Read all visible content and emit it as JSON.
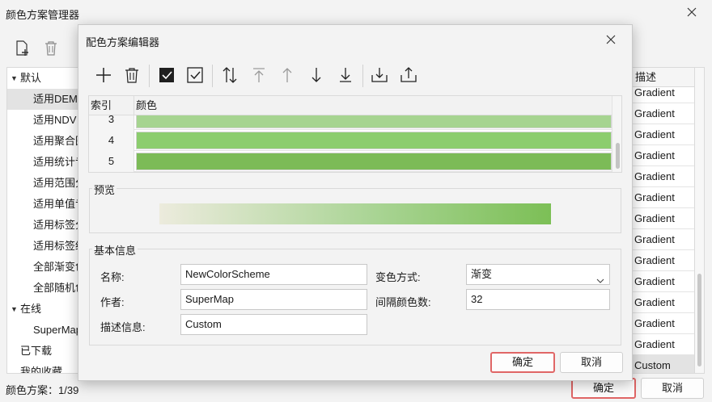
{
  "manager": {
    "title": "颜色方案管理器",
    "tree": {
      "groups": [
        {
          "label": "默认",
          "expanded": true,
          "items": [
            "适用DEM",
            "适用NDV",
            "适用聚合图",
            "适用统计专",
            "适用范围分",
            "适用单值专",
            "适用标签分",
            "适用标签统",
            "全部渐变色",
            "全部随机色"
          ]
        },
        {
          "label": "在线",
          "expanded": true,
          "items": [
            "SuperMap"
          ]
        }
      ],
      "extra": [
        "已下载",
        "我的收藏"
      ]
    },
    "table": {
      "header": "描述",
      "rows": [
        "Gradient",
        "Gradient",
        "Gradient",
        "Gradient",
        "Gradient",
        "Gradient",
        "Gradient",
        "Gradient",
        "Gradient",
        "Gradient",
        "Gradient",
        "Gradient",
        "Gradient",
        "Custom"
      ]
    },
    "status": "颜色方案：1/39",
    "ok_label": "确定",
    "cancel_label": "取消"
  },
  "editor": {
    "title": "配色方案编辑器",
    "grid": {
      "col_index": "索引",
      "col_color": "颜色",
      "rows": [
        {
          "index": "3",
          "color": "#a6d490"
        },
        {
          "index": "4",
          "color": "#8ccd6e"
        },
        {
          "index": "5",
          "color": "#7cbb57"
        }
      ]
    },
    "preview": {
      "label": "预览",
      "gradient_from": "#ecebdd",
      "gradient_mid": "#a9d494",
      "gradient_to": "#7cbf56"
    },
    "info": {
      "label": "基本信息",
      "name_label": "名称:",
      "name_value": "NewColorScheme",
      "author_label": "作者:",
      "author_value": "SuperMap",
      "desc_label": "描述信息:",
      "desc_value": "Custom",
      "mode_label": "变色方式:",
      "mode_value": "渐变",
      "interval_label": "间隔颜色数:",
      "interval_value": "32"
    },
    "ok_label": "确定",
    "cancel_label": "取消"
  },
  "colors": {
    "accent_border": "#e06666"
  }
}
